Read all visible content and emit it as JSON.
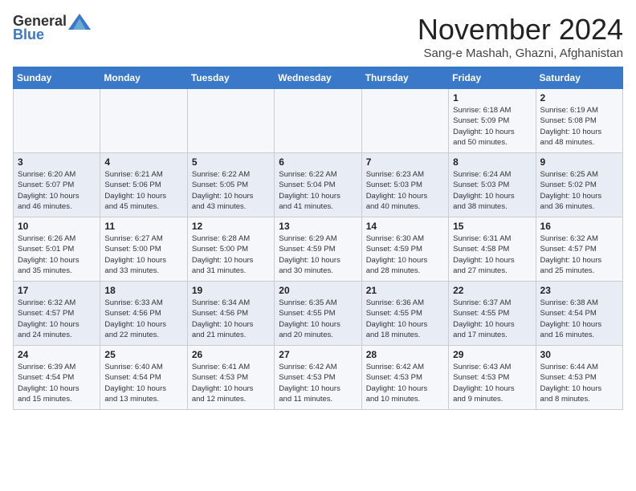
{
  "header": {
    "logo_general": "General",
    "logo_blue": "Blue",
    "month_title": "November 2024",
    "location": "Sang-e Mashah, Ghazni, Afghanistan"
  },
  "weekdays": [
    "Sunday",
    "Monday",
    "Tuesday",
    "Wednesday",
    "Thursday",
    "Friday",
    "Saturday"
  ],
  "weeks": [
    [
      {
        "day": "",
        "details": ""
      },
      {
        "day": "",
        "details": ""
      },
      {
        "day": "",
        "details": ""
      },
      {
        "day": "",
        "details": ""
      },
      {
        "day": "",
        "details": ""
      },
      {
        "day": "1",
        "details": "Sunrise: 6:18 AM\nSunset: 5:09 PM\nDaylight: 10 hours\nand 50 minutes."
      },
      {
        "day": "2",
        "details": "Sunrise: 6:19 AM\nSunset: 5:08 PM\nDaylight: 10 hours\nand 48 minutes."
      }
    ],
    [
      {
        "day": "3",
        "details": "Sunrise: 6:20 AM\nSunset: 5:07 PM\nDaylight: 10 hours\nand 46 minutes."
      },
      {
        "day": "4",
        "details": "Sunrise: 6:21 AM\nSunset: 5:06 PM\nDaylight: 10 hours\nand 45 minutes."
      },
      {
        "day": "5",
        "details": "Sunrise: 6:22 AM\nSunset: 5:05 PM\nDaylight: 10 hours\nand 43 minutes."
      },
      {
        "day": "6",
        "details": "Sunrise: 6:22 AM\nSunset: 5:04 PM\nDaylight: 10 hours\nand 41 minutes."
      },
      {
        "day": "7",
        "details": "Sunrise: 6:23 AM\nSunset: 5:03 PM\nDaylight: 10 hours\nand 40 minutes."
      },
      {
        "day": "8",
        "details": "Sunrise: 6:24 AM\nSunset: 5:03 PM\nDaylight: 10 hours\nand 38 minutes."
      },
      {
        "day": "9",
        "details": "Sunrise: 6:25 AM\nSunset: 5:02 PM\nDaylight: 10 hours\nand 36 minutes."
      }
    ],
    [
      {
        "day": "10",
        "details": "Sunrise: 6:26 AM\nSunset: 5:01 PM\nDaylight: 10 hours\nand 35 minutes."
      },
      {
        "day": "11",
        "details": "Sunrise: 6:27 AM\nSunset: 5:00 PM\nDaylight: 10 hours\nand 33 minutes."
      },
      {
        "day": "12",
        "details": "Sunrise: 6:28 AM\nSunset: 5:00 PM\nDaylight: 10 hours\nand 31 minutes."
      },
      {
        "day": "13",
        "details": "Sunrise: 6:29 AM\nSunset: 4:59 PM\nDaylight: 10 hours\nand 30 minutes."
      },
      {
        "day": "14",
        "details": "Sunrise: 6:30 AM\nSunset: 4:59 PM\nDaylight: 10 hours\nand 28 minutes."
      },
      {
        "day": "15",
        "details": "Sunrise: 6:31 AM\nSunset: 4:58 PM\nDaylight: 10 hours\nand 27 minutes."
      },
      {
        "day": "16",
        "details": "Sunrise: 6:32 AM\nSunset: 4:57 PM\nDaylight: 10 hours\nand 25 minutes."
      }
    ],
    [
      {
        "day": "17",
        "details": "Sunrise: 6:32 AM\nSunset: 4:57 PM\nDaylight: 10 hours\nand 24 minutes."
      },
      {
        "day": "18",
        "details": "Sunrise: 6:33 AM\nSunset: 4:56 PM\nDaylight: 10 hours\nand 22 minutes."
      },
      {
        "day": "19",
        "details": "Sunrise: 6:34 AM\nSunset: 4:56 PM\nDaylight: 10 hours\nand 21 minutes."
      },
      {
        "day": "20",
        "details": "Sunrise: 6:35 AM\nSunset: 4:55 PM\nDaylight: 10 hours\nand 20 minutes."
      },
      {
        "day": "21",
        "details": "Sunrise: 6:36 AM\nSunset: 4:55 PM\nDaylight: 10 hours\nand 18 minutes."
      },
      {
        "day": "22",
        "details": "Sunrise: 6:37 AM\nSunset: 4:55 PM\nDaylight: 10 hours\nand 17 minutes."
      },
      {
        "day": "23",
        "details": "Sunrise: 6:38 AM\nSunset: 4:54 PM\nDaylight: 10 hours\nand 16 minutes."
      }
    ],
    [
      {
        "day": "24",
        "details": "Sunrise: 6:39 AM\nSunset: 4:54 PM\nDaylight: 10 hours\nand 15 minutes."
      },
      {
        "day": "25",
        "details": "Sunrise: 6:40 AM\nSunset: 4:54 PM\nDaylight: 10 hours\nand 13 minutes."
      },
      {
        "day": "26",
        "details": "Sunrise: 6:41 AM\nSunset: 4:53 PM\nDaylight: 10 hours\nand 12 minutes."
      },
      {
        "day": "27",
        "details": "Sunrise: 6:42 AM\nSunset: 4:53 PM\nDaylight: 10 hours\nand 11 minutes."
      },
      {
        "day": "28",
        "details": "Sunrise: 6:42 AM\nSunset: 4:53 PM\nDaylight: 10 hours\nand 10 minutes."
      },
      {
        "day": "29",
        "details": "Sunrise: 6:43 AM\nSunset: 4:53 PM\nDaylight: 10 hours\nand 9 minutes."
      },
      {
        "day": "30",
        "details": "Sunrise: 6:44 AM\nSunset: 4:53 PM\nDaylight: 10 hours\nand 8 minutes."
      }
    ]
  ]
}
